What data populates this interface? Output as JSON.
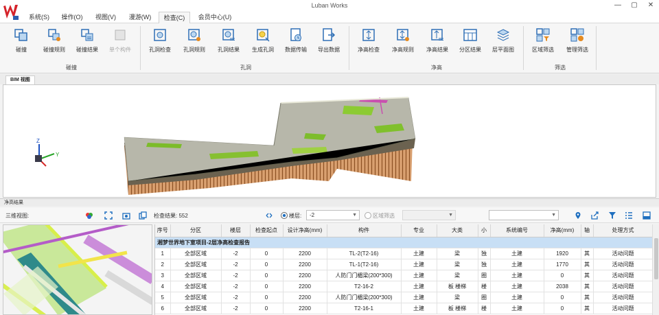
{
  "window": {
    "title": "Luban Works",
    "controls": [
      "—",
      "▢",
      "✕"
    ]
  },
  "menu": [
    "系统(S)",
    "操作(O)",
    "视图(V)",
    "漫游(W)",
    "检查(C)",
    "会员中心(U)"
  ],
  "menu_active": 4,
  "ribbon": {
    "buttons": [
      "碰撞",
      "碰撞规则",
      "碰撞结果",
      "单个构件",
      "孔洞检查",
      "孔洞规则",
      "孔洞结果",
      "生成孔洞",
      "数据传输",
      "导出数据",
      "净高检查",
      "净高规则",
      "净高结果",
      "分区结果",
      "层平面图",
      "区域筛选",
      "管理筛选"
    ],
    "groups": [
      "碰撞",
      "孔洞",
      "净高",
      "筛选"
    ]
  },
  "view_tab": "BIM 视图",
  "panel_title": "净高结果",
  "toolbar": {
    "view_label": "三维视图:",
    "result_label": "检查结果: 552",
    "floor_radio": "楼层:",
    "floor_value": "-2",
    "region_radio": "区域筛选"
  },
  "table": {
    "columns": [
      "序号",
      "分区",
      "楼层",
      "检查起点",
      "设计净高(mm)",
      "构件",
      "专业",
      "大类",
      "小",
      "系统编号",
      "净高(mm)",
      "轴",
      "处理方式"
    ],
    "report_title": "湘梦世界地下室项目-2层净高检查报告",
    "rows": [
      [
        "1",
        "全部区域",
        "-2",
        "0",
        "2200",
        "TL-2(T2-16)",
        "土建",
        "梁",
        "独",
        "土建",
        "1920",
        "其",
        "活动问题"
      ],
      [
        "2",
        "全部区域",
        "-2",
        "0",
        "2200",
        "TL-1(T2-16)",
        "土建",
        "梁",
        "独",
        "土建",
        "1770",
        "其",
        "活动问题"
      ],
      [
        "3",
        "全部区域",
        "-2",
        "0",
        "2200",
        "人防门门楣梁(200*300)",
        "土建",
        "梁",
        "圈",
        "土建",
        "0",
        "其",
        "活动问题"
      ],
      [
        "4",
        "全部区域",
        "-2",
        "0",
        "2200",
        "T2-16-2",
        "土建",
        "板 楼梯",
        "楼",
        "土建",
        "2038",
        "其",
        "活动问题"
      ],
      [
        "5",
        "全部区域",
        "-2",
        "0",
        "2200",
        "人防门门楣梁(200*300)",
        "土建",
        "梁",
        "圈",
        "土建",
        "0",
        "其",
        "活动问题"
      ],
      [
        "6",
        "全部区域",
        "-2",
        "0",
        "2200",
        "T2-16-1",
        "土建",
        "板 楼梯",
        "楼",
        "土建",
        "0",
        "其",
        "活动问题"
      ]
    ]
  },
  "colors": {
    "accent": "#1f6fbf",
    "report_row": "#c8dff5",
    "logo": "#d5232a"
  }
}
